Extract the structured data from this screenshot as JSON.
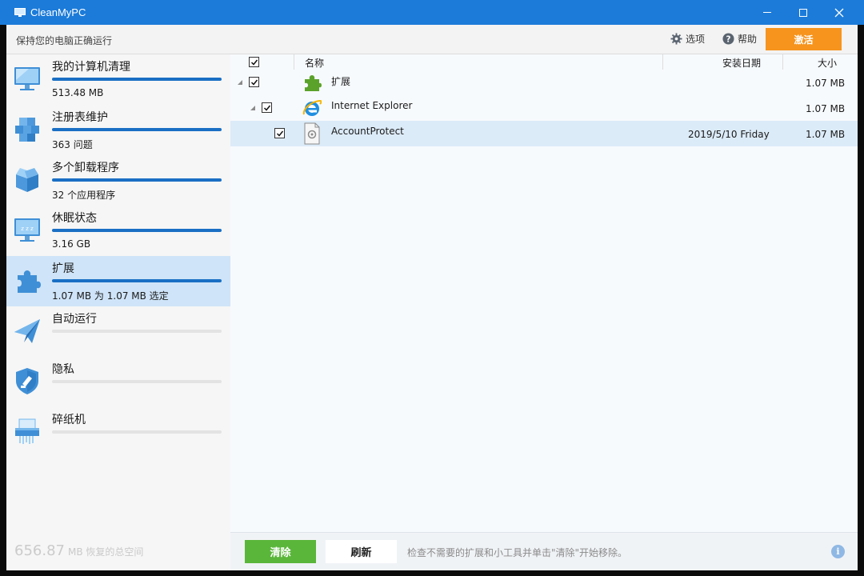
{
  "window": {
    "title": "CleanMyPC",
    "min_icon": "minimize-icon",
    "max_icon": "maximize-icon",
    "close_icon": "close-icon",
    "accent": "#1c7bd9"
  },
  "header": {
    "tagline": "保持您的电脑正确运行",
    "options_label": "选项",
    "help_label": "帮助",
    "activate_label": "激活",
    "activate_color": "#f6941d"
  },
  "sidebar": {
    "items": [
      {
        "label": "我的计算机清理",
        "sub": "513.48 MB",
        "icon": "monitor-icon",
        "progress": 1.0
      },
      {
        "label": "注册表维护",
        "sub": "363 问题",
        "icon": "registry-cubes-icon",
        "progress": 1.0
      },
      {
        "label": "多个卸载程序",
        "sub": "32 个应用程序",
        "icon": "box-icon",
        "progress": 1.0
      },
      {
        "label": "休眠状态",
        "sub": "3.16 GB",
        "icon": "sleep-monitor-icon",
        "progress": 1.0
      },
      {
        "label": "扩展",
        "sub": "1.07 MB 为 1.07 MB 选定",
        "icon": "puzzle-icon",
        "progress": 1.0,
        "active": true
      },
      {
        "label": "自动运行",
        "sub": "",
        "icon": "paper-plane-icon",
        "progress": 0
      },
      {
        "label": "隐私",
        "sub": "",
        "icon": "shield-icon",
        "progress": 0
      },
      {
        "label": "碎纸机",
        "sub": "",
        "icon": "shredder-icon",
        "progress": 0
      }
    ],
    "total_value": "656.87",
    "total_label": "MB 恢复的总空间"
  },
  "table": {
    "columns": {
      "name": "名称",
      "date": "安装日期",
      "size": "大小"
    },
    "rows": [
      {
        "name": "扩展",
        "date": "",
        "size": "1.07 MB",
        "checked": true,
        "icon": "puzzle-icon"
      },
      {
        "name": "Internet Explorer",
        "date": "",
        "size": "1.07 MB",
        "checked": true,
        "icon": "internet-explorer-icon"
      },
      {
        "name": "AccountProtect",
        "date": "2019/5/10 Friday",
        "size": "1.07 MB",
        "checked": true,
        "icon": "extension-file-icon"
      }
    ]
  },
  "footer": {
    "clean_label": "清除",
    "refresh_label": "刷新",
    "hint": "检查不需要的扩展和小工具并单击\"清除\"开始移除。",
    "info_icon": "info-icon",
    "clean_color": "#5ab63a"
  }
}
